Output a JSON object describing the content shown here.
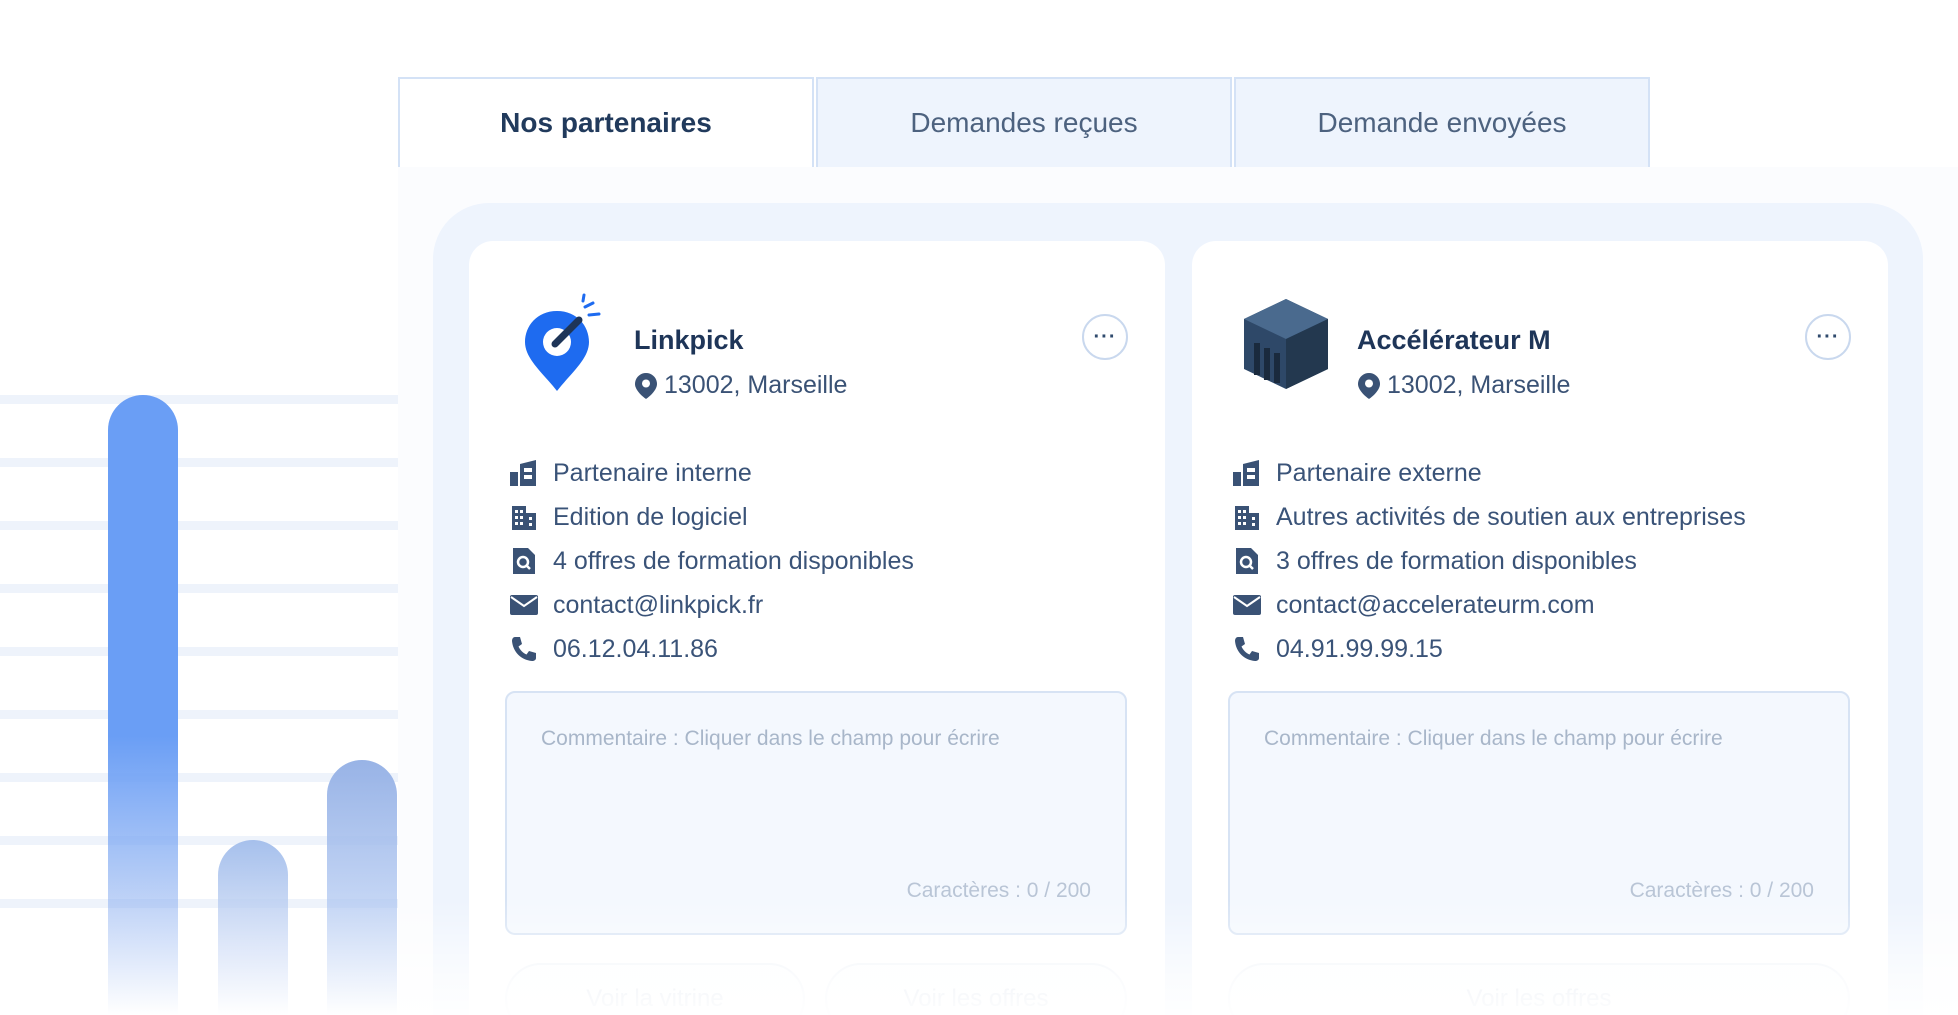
{
  "tabs": [
    {
      "label": "Nos partenaires",
      "active": true
    },
    {
      "label": "Demandes reçues",
      "active": false
    },
    {
      "label": "Demande envoyées",
      "active": false
    }
  ],
  "partners": [
    {
      "name": "Linkpick",
      "location": "13002, Marseille",
      "more_label": "···",
      "type": "Partenaire interne",
      "activity": "Edition de logiciel",
      "offers": "4 offres de formation disponibles",
      "email": "contact@linkpick.fr",
      "phone": "06.12.04.11.86",
      "comment_placeholder": "Commentaire : Cliquer dans le champ pour écrire",
      "char_count": "Caractères : 0 / 200",
      "buttons": [
        "Voir la vitrine",
        "Voir les offres"
      ]
    },
    {
      "name": "Accélérateur M",
      "location": "13002, Marseille",
      "more_label": "···",
      "type": "Partenaire externe",
      "activity": "Autres activités de soutien aux entreprises",
      "offers": "3 offres de formation disponibles",
      "email": "contact@accelerateurm.com",
      "phone": "04.91.99.99.15",
      "comment_placeholder": "Commentaire : Cliquer dans le champ pour écrire",
      "char_count": "Caractères : 0 / 200",
      "buttons": [
        "Voir les offres"
      ]
    }
  ],
  "colors": {
    "accent": "#1e6bf0",
    "primary_text": "#1e3558",
    "panel_bg": "#eef4fd",
    "deco_bar": "#6a9ef5"
  }
}
